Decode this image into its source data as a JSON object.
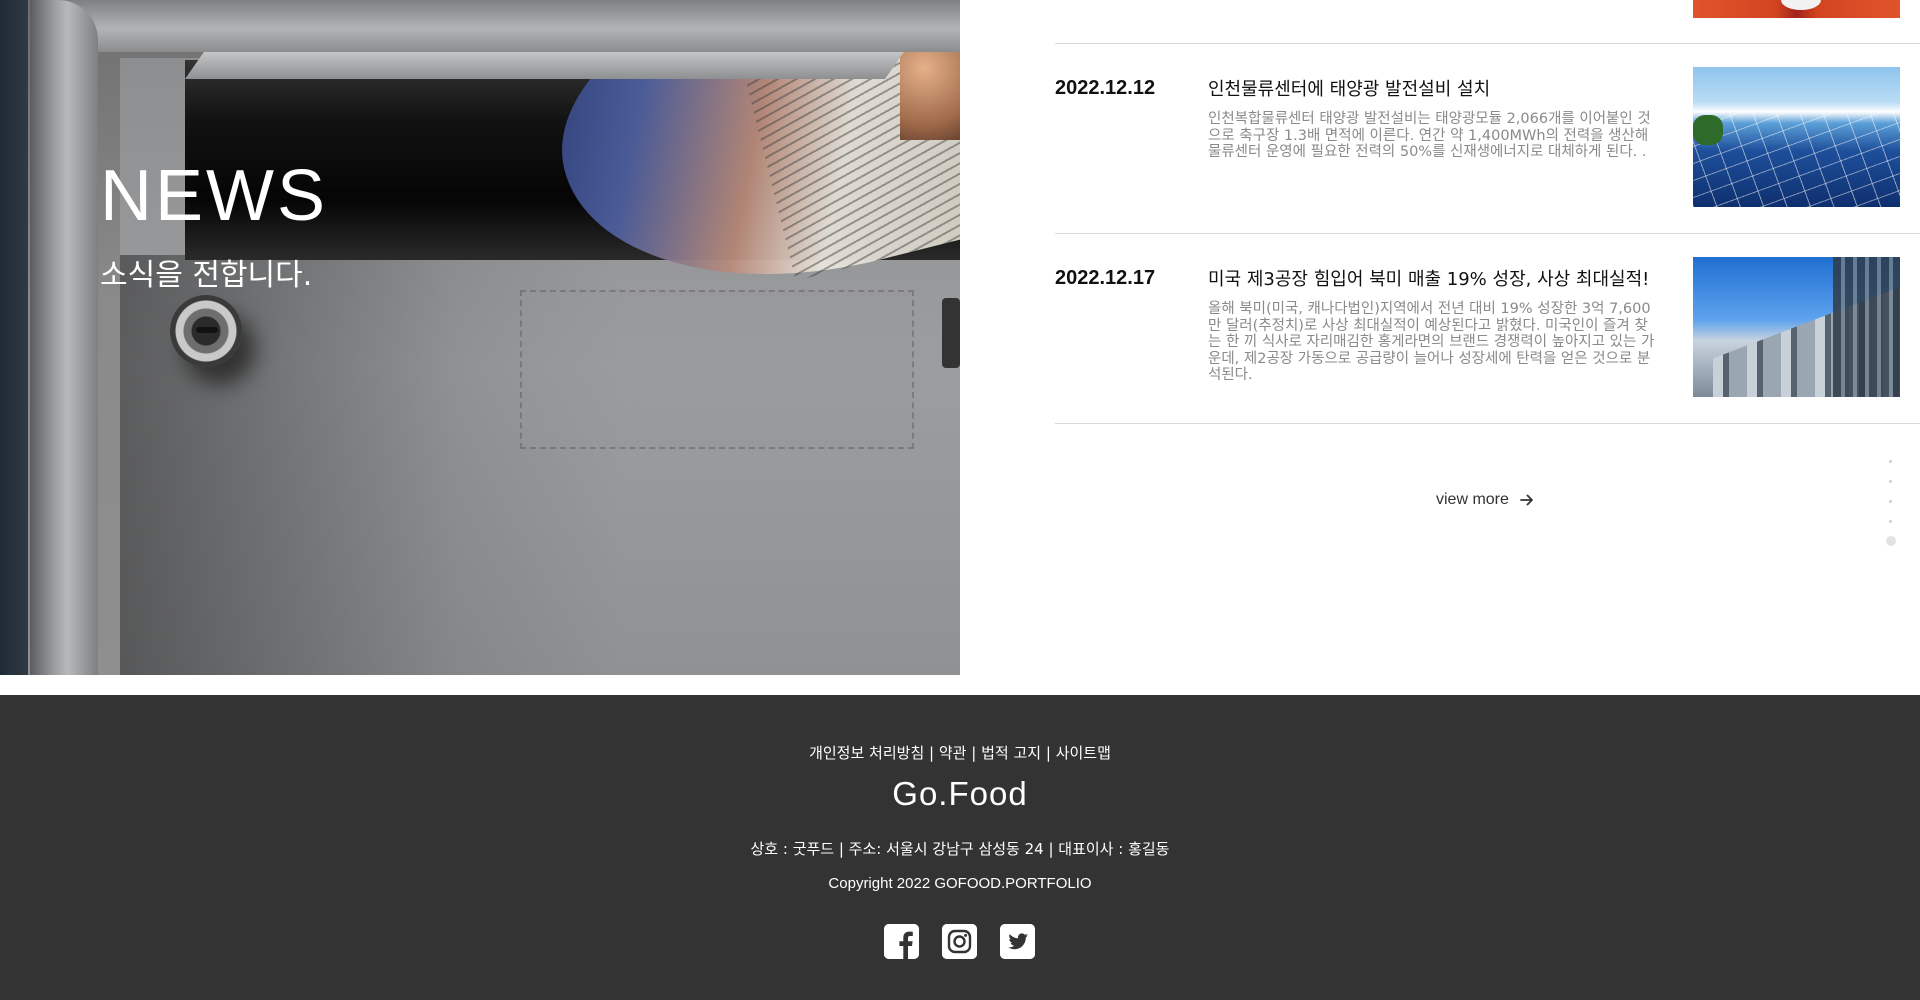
{
  "hero": {
    "title": "NEWS",
    "subtitle": "소식을 전합니다."
  },
  "news": [
    {
      "date": "2022.12.12",
      "title": "인천물류센터에 태양광 발전설비 설치",
      "description": "인천복합물류센터 태양광 발전설비는 태양광모듈 2,066개를 이어붙인 것으로 축구장 1.3배 면적에 이른다. 연간 약 1,400MWh의 전력을 생산해 물류센터 운영에 필요한 전력의 50%를 신재생에너지로 대체하게 된다. .",
      "thumbnail": "solar-panel-image"
    },
    {
      "date": "2022.12.17",
      "title": "미국 제3공장 힘입어 북미 매출 19% 성장, 사상 최대실적!",
      "description": "올해 북미(미국, 캐나다법인)지역에서 전년 대비 19% 성장한 3억 7,600만 달러(추정치)로 사상 최대실적이 예상된다고 밝혔다. 미국인이 즐겨 찾는 한 끼 식사로 자리매김한 홍게라면의 브랜드 경쟁력이 높아지고 있는 가운데, 제2공장 가동으로 공급량이 늘어나 성장세에 탄력을 얻은 것으로 분석된다.",
      "thumbnail": "factory-building-image"
    }
  ],
  "view_more": {
    "label": "view more",
    "icon": "arrow-right-icon"
  },
  "pagination": {
    "total": 5,
    "active_index": 5
  },
  "footer": {
    "links": [
      "개인정보 처리방침",
      "약관",
      "법적 고지",
      "사이트맵"
    ],
    "separator": "|",
    "logo": "Go.Food",
    "info": "상호 : 굿푸드 | 주소: 서울시 강남구 삼성동 24 | 대표이사 : 홍길동",
    "copyright": "Copyright 2022 GOFOOD.PORTFOLIO",
    "social": [
      {
        "name": "facebook",
        "icon": "facebook-icon"
      },
      {
        "name": "instagram",
        "icon": "instagram-icon"
      },
      {
        "name": "twitter",
        "icon": "twitter-icon"
      }
    ]
  },
  "colors": {
    "footer_bg": "#333333",
    "text_dark": "#111111",
    "text_muted": "#8a8a8a",
    "divider": "#d9d9d9"
  }
}
